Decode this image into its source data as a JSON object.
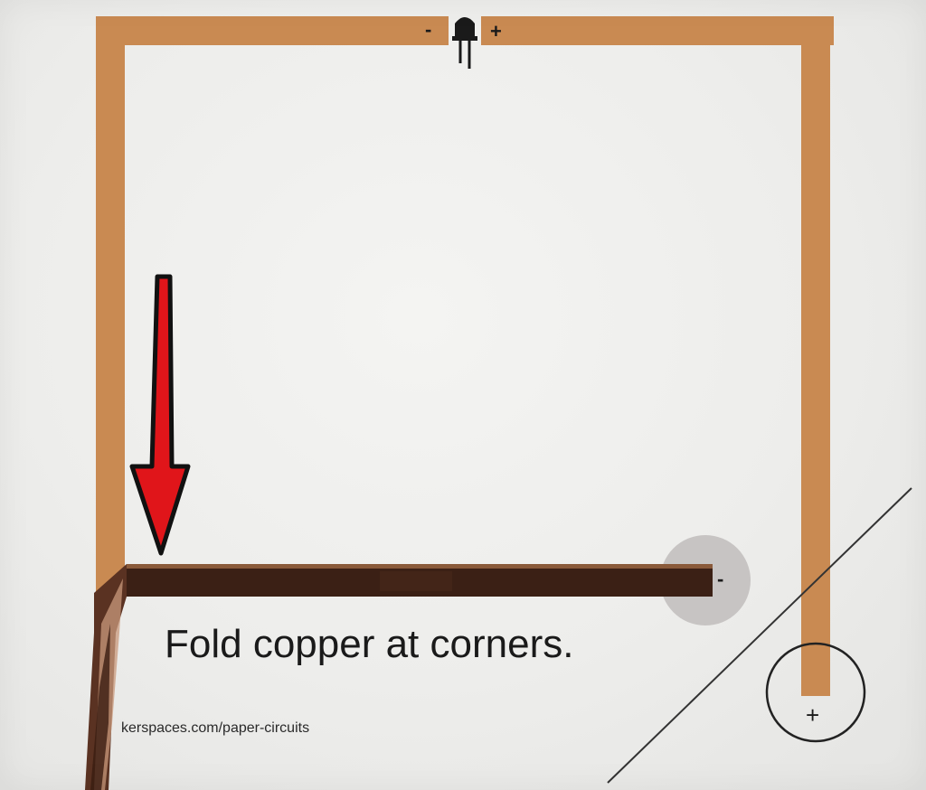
{
  "caption": "Fold copper at corners.",
  "url_fragment": "kerspaces.com/paper-circuits",
  "led": {
    "minus_label": "-",
    "plus_label": "+"
  },
  "battery": {
    "minus_label": "-"
  },
  "corner": {
    "plus_label": "+"
  },
  "colors": {
    "copper_trace": "#c98a52",
    "copper_tape": "#3a1f12",
    "arrow": "#e0151a",
    "paper": "#efefed"
  },
  "icons": [
    "led-icon",
    "down-arrow-icon",
    "battery-spot-icon",
    "corner-circle-icon",
    "fold-line-icon"
  ]
}
